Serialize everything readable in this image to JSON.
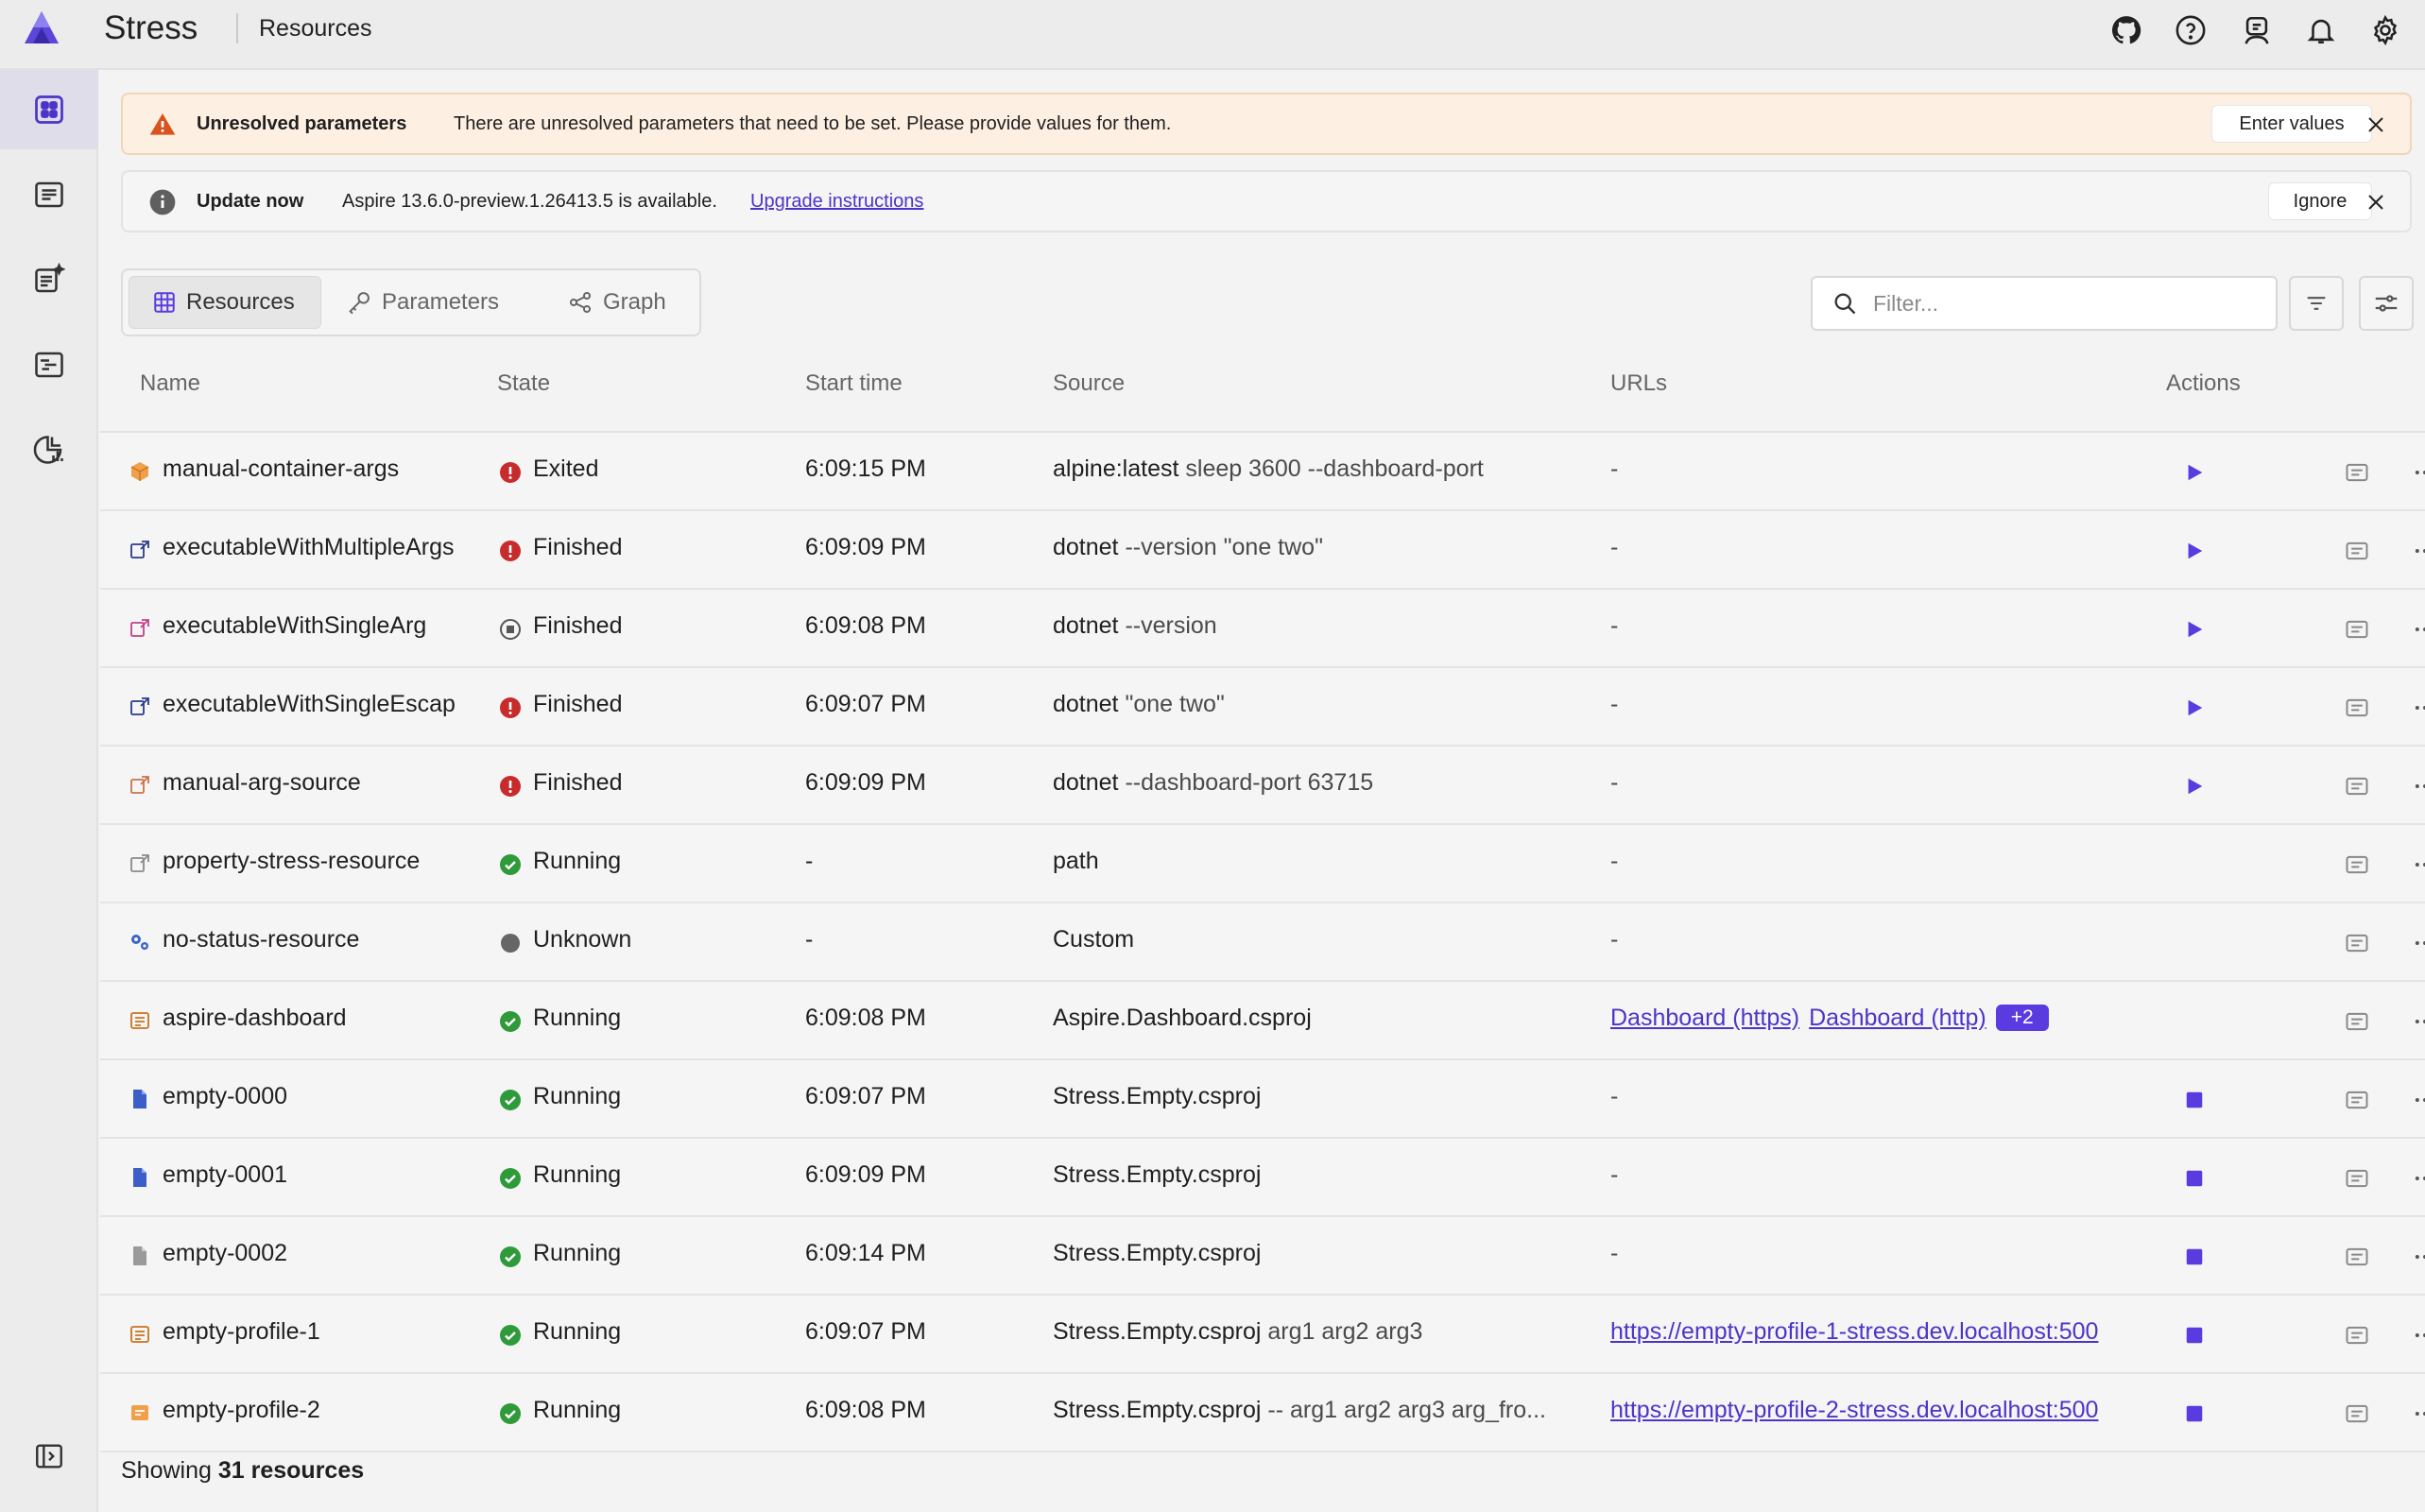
{
  "header": {
    "app_title": "Stress",
    "page": "Resources",
    "icons": [
      "github-icon",
      "help-icon",
      "user-icon",
      "bell-icon",
      "settings-icon"
    ]
  },
  "rail": {
    "items": [
      "resources-icon",
      "console-logs-icon",
      "structured-logs-icon",
      "traces-icon",
      "metrics-icon"
    ],
    "bottom": "collapse-panel-icon"
  },
  "banners": {
    "warning": {
      "title": "Unresolved parameters",
      "message": "There are unresolved parameters that need to be set. Please provide values for them.",
      "action": "Enter values"
    },
    "update": {
      "title": "Update now",
      "message": "Aspire 13.6.0-preview.1.26413.5 is available.",
      "link": "Upgrade instructions",
      "action": "Ignore"
    }
  },
  "tabs": [
    {
      "label": "Resources",
      "icon": "table-icon"
    },
    {
      "label": "Parameters",
      "icon": "key-icon"
    },
    {
      "label": "Graph",
      "icon": "graph-icon"
    }
  ],
  "filter": {
    "placeholder": "Filter..."
  },
  "columns": {
    "name": "Name",
    "state": "State",
    "start": "Start time",
    "source": "Source",
    "urls": "URLs",
    "actions": "Actions"
  },
  "rows": [
    {
      "name": "manual-container-args",
      "icon": "container",
      "state": "Exited",
      "status": "error",
      "start": "6:09:15 PM",
      "src_main": "alpine:latest",
      "src_args": " sleep 3600 --dashboard-port",
      "urls": [],
      "url_text": "-",
      "action": "start"
    },
    {
      "name": "executableWithMultipleArgs",
      "icon": "executable",
      "state": "Finished",
      "status": "error",
      "start": "6:09:09 PM",
      "src_main": "dotnet",
      "src_args": " --version \"one two\"",
      "urls": [],
      "url_text": "-",
      "action": "start"
    },
    {
      "name": "executableWithSingleArg",
      "icon": "executable-pink",
      "state": "Finished",
      "status": "stopped",
      "start": "6:09:08 PM",
      "src_main": "dotnet",
      "src_args": " --version",
      "urls": [],
      "url_text": "-",
      "action": "start"
    },
    {
      "name": "executableWithSingleEscap",
      "icon": "executable",
      "state": "Finished",
      "status": "error",
      "start": "6:09:07 PM",
      "src_main": "dotnet",
      "src_args": " \"one two\"",
      "urls": [],
      "url_text": "-",
      "action": "start"
    },
    {
      "name": "manual-arg-source",
      "icon": "executable-orange",
      "state": "Finished",
      "status": "error",
      "start": "6:09:09 PM",
      "src_main": "dotnet",
      "src_args": " --dashboard-port 63715",
      "urls": [],
      "url_text": "-",
      "action": "start"
    },
    {
      "name": "property-stress-resource",
      "icon": "executable-gray",
      "state": "Running",
      "status": "running",
      "start": "-",
      "src_main": "path",
      "src_args": "",
      "urls": [],
      "url_text": "-",
      "action": "none"
    },
    {
      "name": "no-status-resource",
      "icon": "gears",
      "state": "Unknown",
      "status": "unknown",
      "start": "-",
      "src_main": "Custom",
      "src_args": "",
      "urls": [],
      "url_text": "-",
      "action": "none"
    },
    {
      "name": "aspire-dashboard",
      "icon": "project-orange",
      "state": "Running",
      "status": "running",
      "start": "6:09:08 PM",
      "src_main": "Aspire.Dashboard.csproj",
      "src_args": "",
      "urls": [
        "Dashboard (https)",
        "Dashboard (http)"
      ],
      "url_more": "+2",
      "url_text": "",
      "action": "none"
    },
    {
      "name": "empty-0000",
      "icon": "file-blue",
      "state": "Running",
      "status": "running",
      "start": "6:09:07 PM",
      "src_main": "Stress.Empty.csproj",
      "src_args": "",
      "urls": [],
      "url_text": "-",
      "action": "stop"
    },
    {
      "name": "empty-0001",
      "icon": "file-blue",
      "state": "Running",
      "status": "running",
      "start": "6:09:09 PM",
      "src_main": "Stress.Empty.csproj",
      "src_args": "",
      "urls": [],
      "url_text": "-",
      "action": "stop"
    },
    {
      "name": "empty-0002",
      "icon": "file-gray",
      "state": "Running",
      "status": "running",
      "start": "6:09:14 PM",
      "src_main": "Stress.Empty.csproj",
      "src_args": "",
      "urls": [],
      "url_text": "-",
      "action": "stop"
    },
    {
      "name": "empty-profile-1",
      "icon": "project-orange",
      "state": "Running",
      "status": "running",
      "start": "6:09:07 PM",
      "src_main": "Stress.Empty.csproj",
      "src_args": " arg1 arg2 arg3",
      "urls": [
        "https://empty-profile-1-stress.dev.localhost:500"
      ],
      "url_text": "",
      "action": "stop"
    },
    {
      "name": "empty-profile-2",
      "icon": "project-orange2",
      "state": "Running",
      "status": "running",
      "start": "6:09:08 PM",
      "src_main": "Stress.Empty.csproj",
      "src_args": " -- arg1 arg2 arg3 arg_fro...",
      "urls": [
        "https://empty-profile-2-stress.dev.localhost:500"
      ],
      "url_text": "",
      "action": "stop"
    }
  ],
  "footer": {
    "prefix": "Showing ",
    "count": "31 resources"
  },
  "colors": {
    "accent": "#5a3be0",
    "running": "#2f9a3a",
    "error": "#c82b2b",
    "warning": "#d9531e",
    "link": "#4d34c9"
  }
}
